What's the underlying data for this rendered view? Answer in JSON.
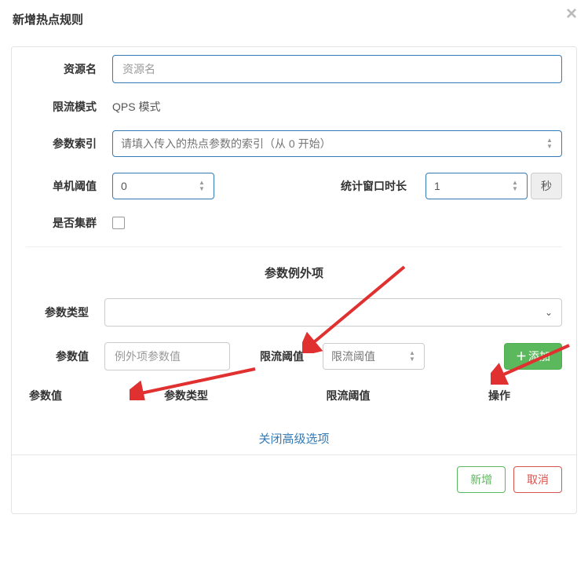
{
  "header": {
    "title": "新增热点规则"
  },
  "form": {
    "resource": {
      "label": "资源名",
      "placeholder": "资源名"
    },
    "mode": {
      "label": "限流模式",
      "value": "QPS 模式"
    },
    "paramIdx": {
      "label": "参数索引",
      "placeholder": "请填入传入的热点参数的索引（从 0 开始）"
    },
    "threshold": {
      "label": "单机阈值",
      "value": "0"
    },
    "window": {
      "label": "统计窗口时长",
      "value": "1",
      "unit": "秒"
    },
    "cluster": {
      "label": "是否集群"
    }
  },
  "exception": {
    "title": "参数例外项",
    "paramType": {
      "label": "参数类型"
    },
    "paramVal": {
      "label": "参数值",
      "placeholder": "例外项参数值"
    },
    "flowLimit": {
      "label": "限流阈值",
      "placeholder": "限流阈值"
    },
    "addBtn": "添加",
    "table": {
      "col1": "参数值",
      "col2": "参数类型",
      "col3": "限流阈值",
      "col4": "操作"
    },
    "closeAdv": "关闭高级选项"
  },
  "footer": {
    "ok": "新增",
    "cancel": "取消"
  }
}
